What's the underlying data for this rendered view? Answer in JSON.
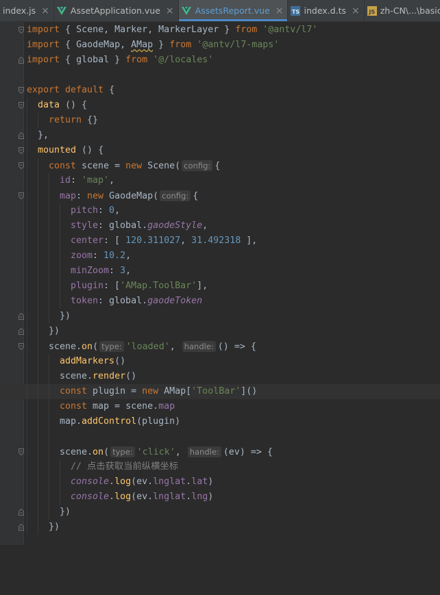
{
  "tabs": [
    {
      "label": "index.js",
      "icon": "js-file-icon",
      "active": false
    },
    {
      "label": "AssetApplication.vue",
      "icon": "vue-file-icon",
      "active": false
    },
    {
      "label": "AssetsReport.vue",
      "icon": "vue-file-icon",
      "active": true
    },
    {
      "label": "index.d.ts",
      "icon": "ts-file-icon",
      "active": false
    },
    {
      "label": "zh-CN\\...\\basicTable.",
      "icon": "js-file-icon",
      "active": false
    }
  ],
  "close_glyph": "×",
  "code": {
    "l1": {
      "a": "import",
      "b": " { Scene, Marker, MarkerLayer } ",
      "c": "from",
      "d": " ",
      "e": "'@antv/l7'"
    },
    "l2": {
      "a": "import",
      "b": " { GaodeMap, ",
      "w": "AMap",
      "b2": " } ",
      "c": "from",
      "d": " ",
      "e": "'@antv/l7-maps'"
    },
    "l3": {
      "a": "import",
      "b": " { global } ",
      "c": "from",
      "d": " ",
      "e": "'@/locales'"
    },
    "l5": {
      "a": "export default",
      "b": " {"
    },
    "l6": {
      "a": "data",
      "b": " () {"
    },
    "l7": {
      "a": "return",
      "b": " {}"
    },
    "l8": {
      "a": "},"
    },
    "l9": {
      "a": "mounted",
      "b": " () {"
    },
    "l10": {
      "a": "const",
      "b": " scene = ",
      "c": "new",
      "d": " Scene(",
      "hint": "config:",
      "e": "{"
    },
    "l11": {
      "a": "id",
      "b": ": ",
      "c": "'map'",
      "d": ","
    },
    "l12": {
      "a": "map",
      "b": ": ",
      "c": "new",
      "d": " GaodeMap(",
      "hint": "config:",
      "e": "{"
    },
    "l13": {
      "a": "pitch",
      "b": ": ",
      "c": "0",
      "d": ","
    },
    "l14": {
      "a": "style",
      "b": ": global.",
      "c": "gaodeStyle",
      "d": ","
    },
    "l15": {
      "a": "center",
      "b": ": [ ",
      "c": "120.311027",
      "d": ", ",
      "e": "31.492318",
      "f": " ],"
    },
    "l16": {
      "a": "zoom",
      "b": ": ",
      "c": "10.2",
      "d": ","
    },
    "l17": {
      "a": "minZoom",
      "b": ": ",
      "c": "3",
      "d": ","
    },
    "l18": {
      "a": "plugin",
      "b": ": [",
      "c": "'AMap.ToolBar'",
      "d": "],"
    },
    "l19": {
      "a": "token",
      "b": ": global.",
      "c": "gaodeToken"
    },
    "l20": {
      "a": "})"
    },
    "l21": {
      "a": "})"
    },
    "l22": {
      "a": "scene.",
      "b": "on",
      "c": "(",
      "hint1": "type:",
      "d": "'loaded'",
      "e": ", ",
      "hint2": "handle:",
      "f": "() => {"
    },
    "l23": {
      "a": "addMarkers",
      "b": "()"
    },
    "l24": {
      "a": "scene.",
      "b": "render",
      "c": "()"
    },
    "l25": {
      "a": "const",
      "b": " plugin = ",
      "c": "new",
      "d": " AMap[",
      "e": "'ToolBar'",
      "f": "]()"
    },
    "l26": {
      "a": "const",
      "b": " map = scene.",
      "c": "map"
    },
    "l27": {
      "a": "map.",
      "b": "addControl",
      "c": "(plugin)"
    },
    "l29": {
      "a": "scene.",
      "b": "on",
      "c": "(",
      "hint1": "type:",
      "d": "'click'",
      "e": ", ",
      "hint2": "handle:",
      "f": "(ev) => {"
    },
    "l30": {
      "a": "// 点击获取当前纵横坐标"
    },
    "l31": {
      "a": "console",
      "b": ".",
      "c": "log",
      "d": "(ev.",
      "e": "lnglat",
      "f": ".",
      "g": "lat",
      "h": ")"
    },
    "l32": {
      "a": "console",
      "b": ".",
      "c": "log",
      "d": "(ev.",
      "e": "lnglat",
      "f": ".",
      "g": "lng",
      "h": ")"
    },
    "l33": {
      "a": "})"
    },
    "l34": {
      "a": "})"
    }
  }
}
